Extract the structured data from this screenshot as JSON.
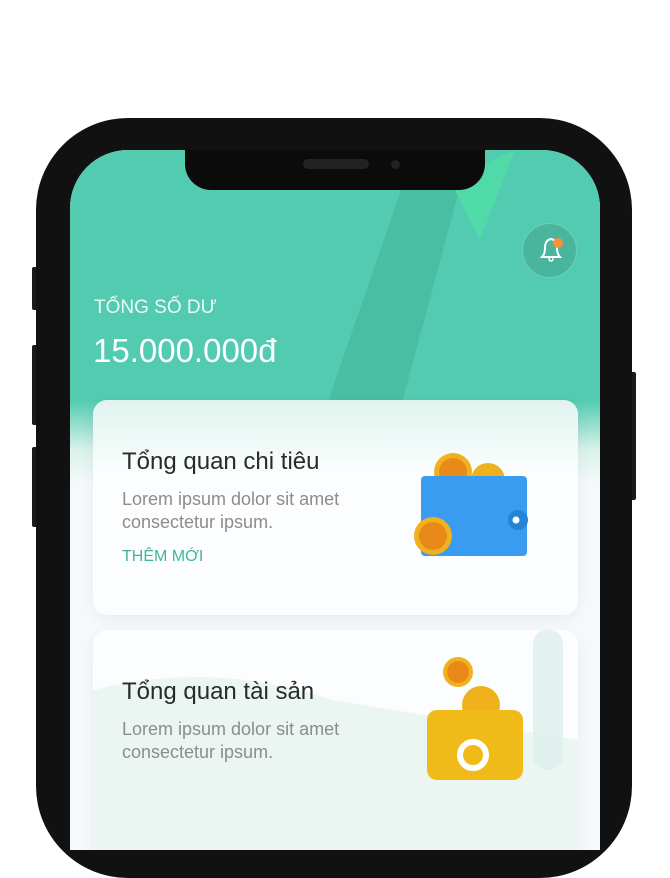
{
  "header": {
    "balance_label": "TỔNG SỐ DƯ",
    "balance_value": "15.000.000đ",
    "notification_color": "#f7913a"
  },
  "cards": [
    {
      "title": "Tổng quan chi tiêu",
      "description": "Lorem ipsum dolor sit amet consectetur ipsum.",
      "action": "THÊM MỚI",
      "icon": "wallet-coins-icon"
    },
    {
      "title": "Tổng quan tài sản",
      "description": "Lorem ipsum dolor sit amet consectetur ipsum.",
      "icon": "piggy-coins-icon"
    }
  ],
  "colors": {
    "primary": "#52cbb0",
    "accent": "#3fb796"
  }
}
